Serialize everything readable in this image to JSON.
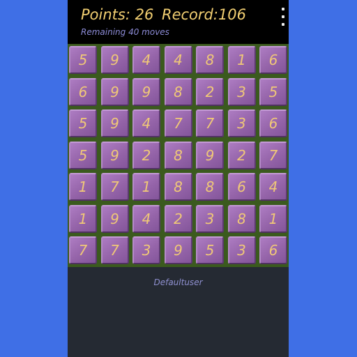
{
  "header": {
    "points": "Points: 26",
    "record": "Record:106",
    "remaining": "Remaining 40 moves",
    "menu_icon": "overflow-menu-icon"
  },
  "board": {
    "rows": [
      [
        "5",
        "9",
        "4",
        "4",
        "8",
        "1",
        "6"
      ],
      [
        "6",
        "9",
        "9",
        "8",
        "2",
        "3",
        "5"
      ],
      [
        "5",
        "9",
        "4",
        "7",
        "7",
        "3",
        "6"
      ],
      [
        "5",
        "9",
        "2",
        "8",
        "9",
        "2",
        "7"
      ],
      [
        "1",
        "7",
        "1",
        "8",
        "8",
        "6",
        "4"
      ],
      [
        "1",
        "9",
        "4",
        "2",
        "3",
        "8",
        "1"
      ],
      [
        "7",
        "7",
        "3",
        "9",
        "5",
        "3",
        "6"
      ]
    ]
  },
  "footer": {
    "username": "Defaultuser"
  },
  "colors": {
    "background": "#3f6fe6",
    "panel": "#252a33",
    "header": "#000000",
    "board": "#3b5a1e",
    "tile": "#9564a9",
    "digit": "#f0c877",
    "score_text": "#f2cf72",
    "secondary_text": "#8d8cd8"
  }
}
